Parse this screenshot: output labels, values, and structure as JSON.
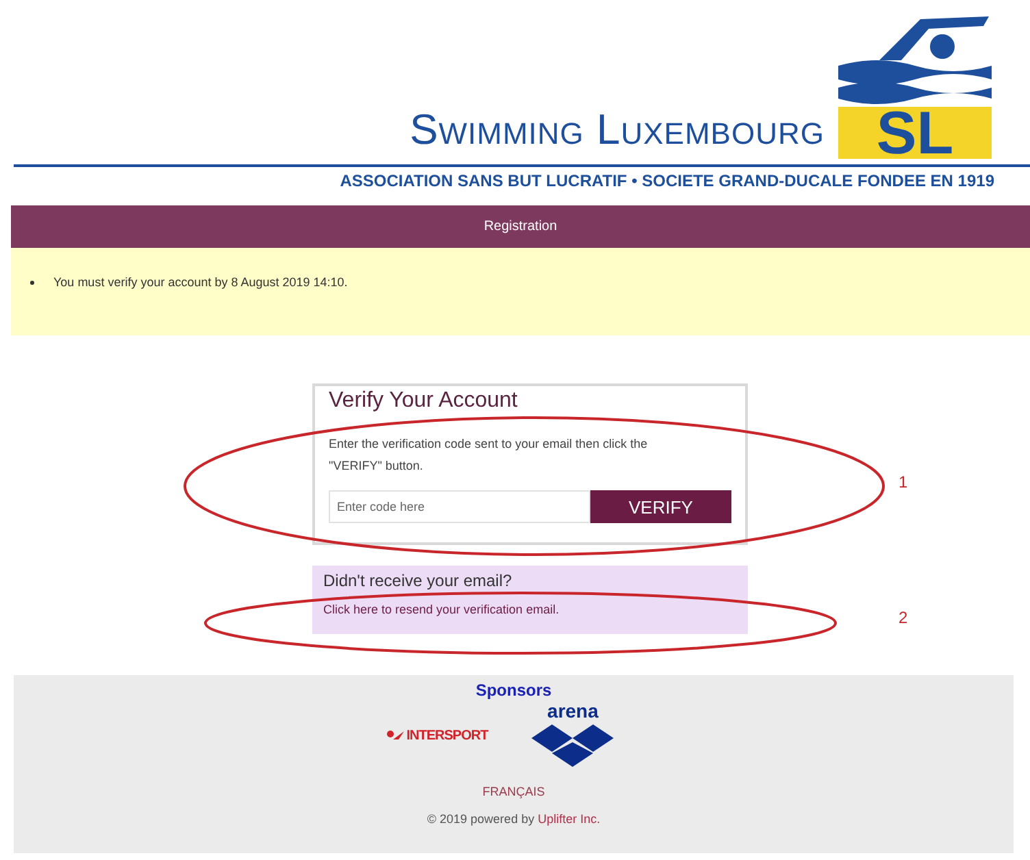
{
  "header": {
    "title": "Swimming Luxembourg",
    "logo_letters": "SL",
    "subtitle": "ASSOCIATION SANS BUT LUCRATIF • SOCIETE GRAND-DUCALE FONDEE EN 1919"
  },
  "nav_bar": {
    "title": "Registration"
  },
  "notices": [
    "You must verify your account by 8 August 2019 14:10."
  ],
  "verify_card": {
    "title": "Verify Your Account",
    "instructions": "Enter the verification code sent to your email then click the \"VERIFY\" button.",
    "code_field": {
      "placeholder": "Enter code here"
    },
    "button": "VERIFY"
  },
  "resend_box": {
    "title": "Didn't receive your email?",
    "link": "Click here to resend your verification email."
  },
  "annotations": [
    {
      "label": "1"
    },
    {
      "label": "2"
    }
  ],
  "footer": {
    "sponsors_title": "Sponsors",
    "sponsors": [
      {
        "kind": "intersport",
        "name": "INTERSPORT"
      },
      {
        "kind": "arena",
        "name": "arena"
      }
    ],
    "language_link": "FRANÇAIS",
    "copyright": "© 2019 powered by ",
    "powered_link": "Uplifter Inc."
  }
}
